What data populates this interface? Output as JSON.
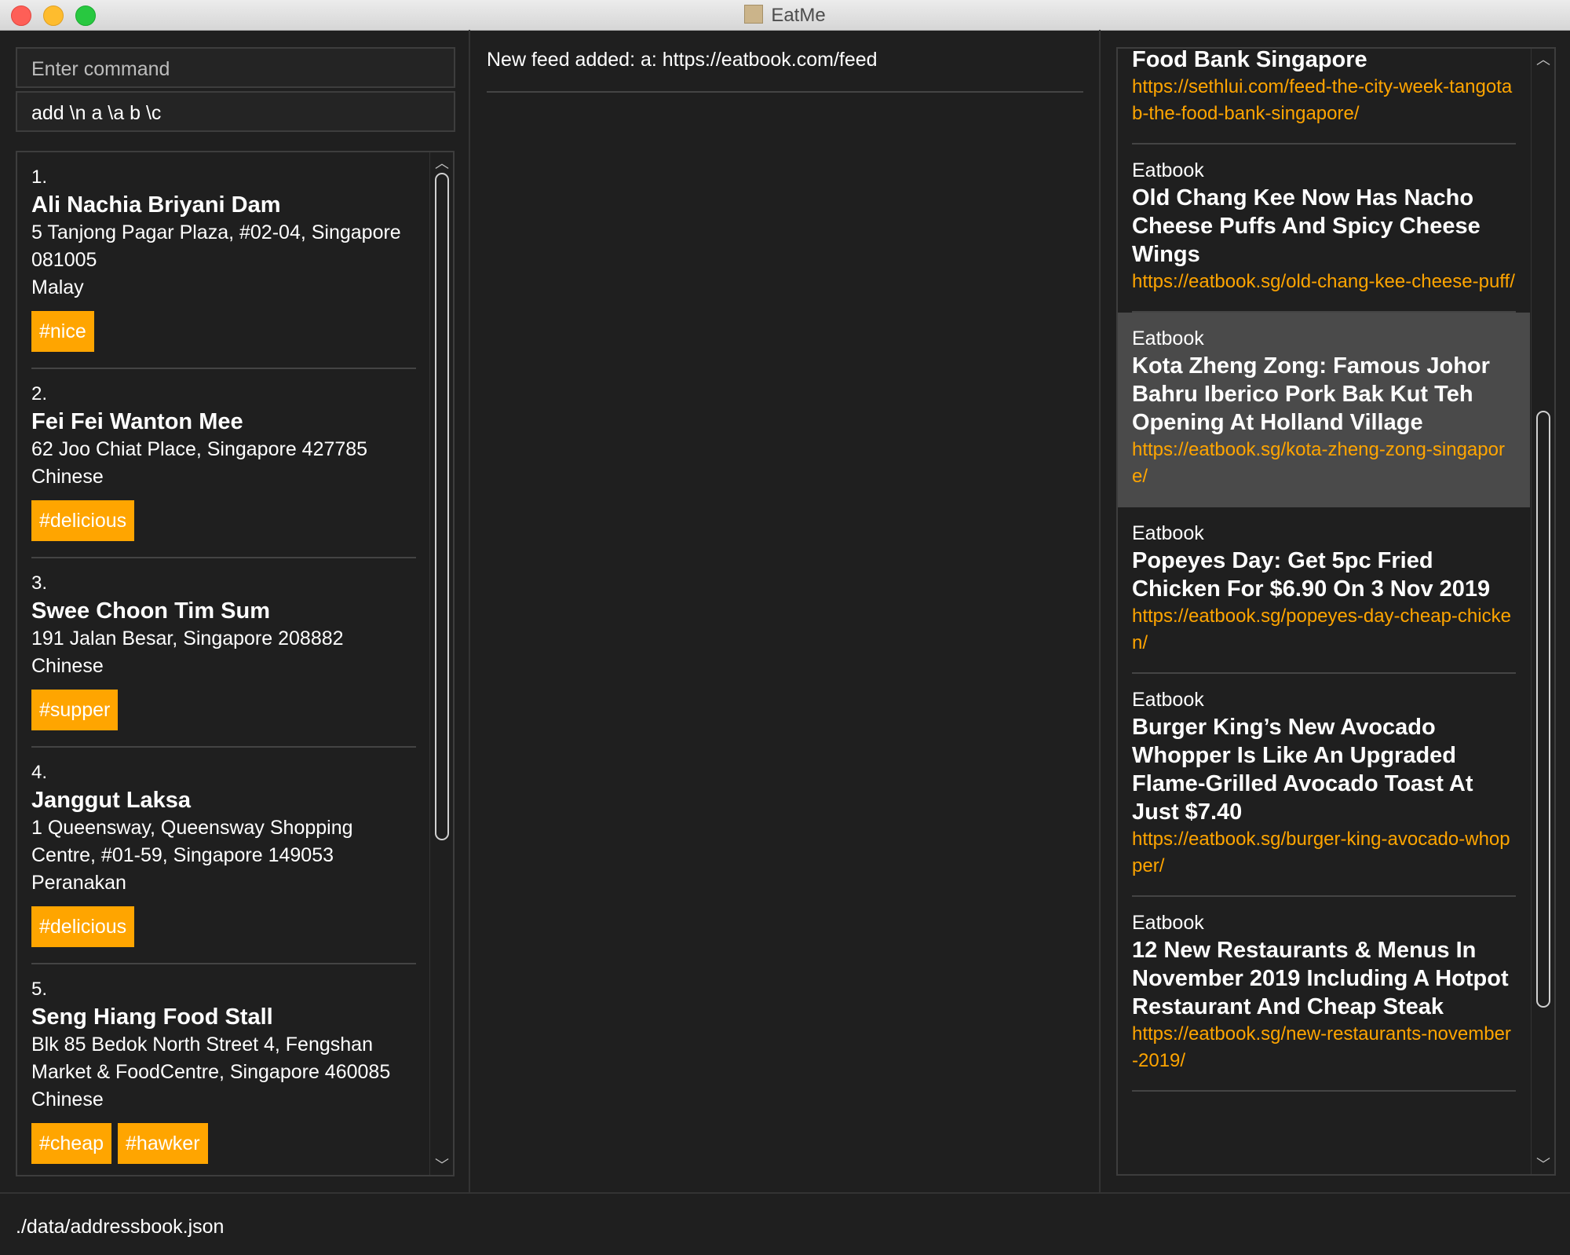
{
  "window": {
    "title": "EatMe"
  },
  "command": {
    "placeholder": "Enter command",
    "value": "add \\n a \\a b  \\c"
  },
  "status": {
    "message": "New feed added: a: https://eatbook.com/feed"
  },
  "restaurants": [
    {
      "index": "1.",
      "name": "Ali Nachia Briyani Dam",
      "address": "5 Tanjong Pagar Plaza, #02-04, Singapore 081005",
      "category": "Malay",
      "tags": [
        "#nice"
      ]
    },
    {
      "index": "2.",
      "name": "Fei Fei Wanton Mee",
      "address": "62 Joo Chiat Place, Singapore 427785",
      "category": "Chinese",
      "tags": [
        "#delicious"
      ]
    },
    {
      "index": "3.",
      "name": "Swee Choon Tim Sum",
      "address": "191 Jalan Besar, Singapore 208882",
      "category": "Chinese",
      "tags": [
        "#supper"
      ]
    },
    {
      "index": "4.",
      "name": "Janggut Laksa",
      "address": "1 Queensway, Queensway Shopping Centre, #01-59, Singapore 149053",
      "category": "Peranakan",
      "tags": [
        "#delicious"
      ]
    },
    {
      "index": "5.",
      "name": "Seng Hiang Food Stall",
      "address": "Blk 85 Bedok North Street 4, Fengshan Market & FoodCentre, Singapore 460085",
      "category": "Chinese",
      "tags": [
        "#cheap",
        "#hawker"
      ]
    }
  ],
  "feeds": [
    {
      "source": "",
      "title": "Food Bank Singapore",
      "link": "https://sethlui.com/feed-the-city-week-tangotab-the-food-bank-singapore/",
      "selected": false
    },
    {
      "source": "Eatbook",
      "title": "Old Chang Kee Now Has Nacho Cheese Puffs And Spicy Cheese Wings",
      "link": "https://eatbook.sg/old-chang-kee-cheese-puff/",
      "selected": false
    },
    {
      "source": "Eatbook",
      "title": "Kota Zheng Zong: Famous Johor Bahru Iberico Pork Bak Kut Teh Opening At Holland Village",
      "link": "https://eatbook.sg/kota-zheng-zong-singapore/",
      "selected": true
    },
    {
      "source": "Eatbook",
      "title": "Popeyes Day: Get 5pc Fried Chicken For $6.90 On 3 Nov 2019",
      "link": "https://eatbook.sg/popeyes-day-cheap-chicken/",
      "selected": false
    },
    {
      "source": "Eatbook",
      "title": "Burger King’s New Avocado Whopper Is Like An Upgraded Flame-Grilled Avocado Toast At Just $7.40",
      "link": "https://eatbook.sg/burger-king-avocado-whopper/",
      "selected": false
    },
    {
      "source": "Eatbook",
      "title": "12 New Restaurants & Menus In November 2019 Including A Hotpot Restaurant And Cheap Steak",
      "link": "https://eatbook.sg/new-restaurants-november-2019/",
      "selected": false
    }
  ],
  "footer": {
    "storage_path": "./data/addressbook.json"
  },
  "scrollbars": {
    "restaurant_list": {
      "position": 0.0,
      "visible_fraction": 0.68
    },
    "feed_list": {
      "position": 0.7,
      "visible_fraction": 0.55
    }
  },
  "colors": {
    "tag_bg": "#ffa500",
    "link": "#ffa500",
    "background": "#1f1f1f",
    "selected_bg": "#4a4a4a"
  }
}
